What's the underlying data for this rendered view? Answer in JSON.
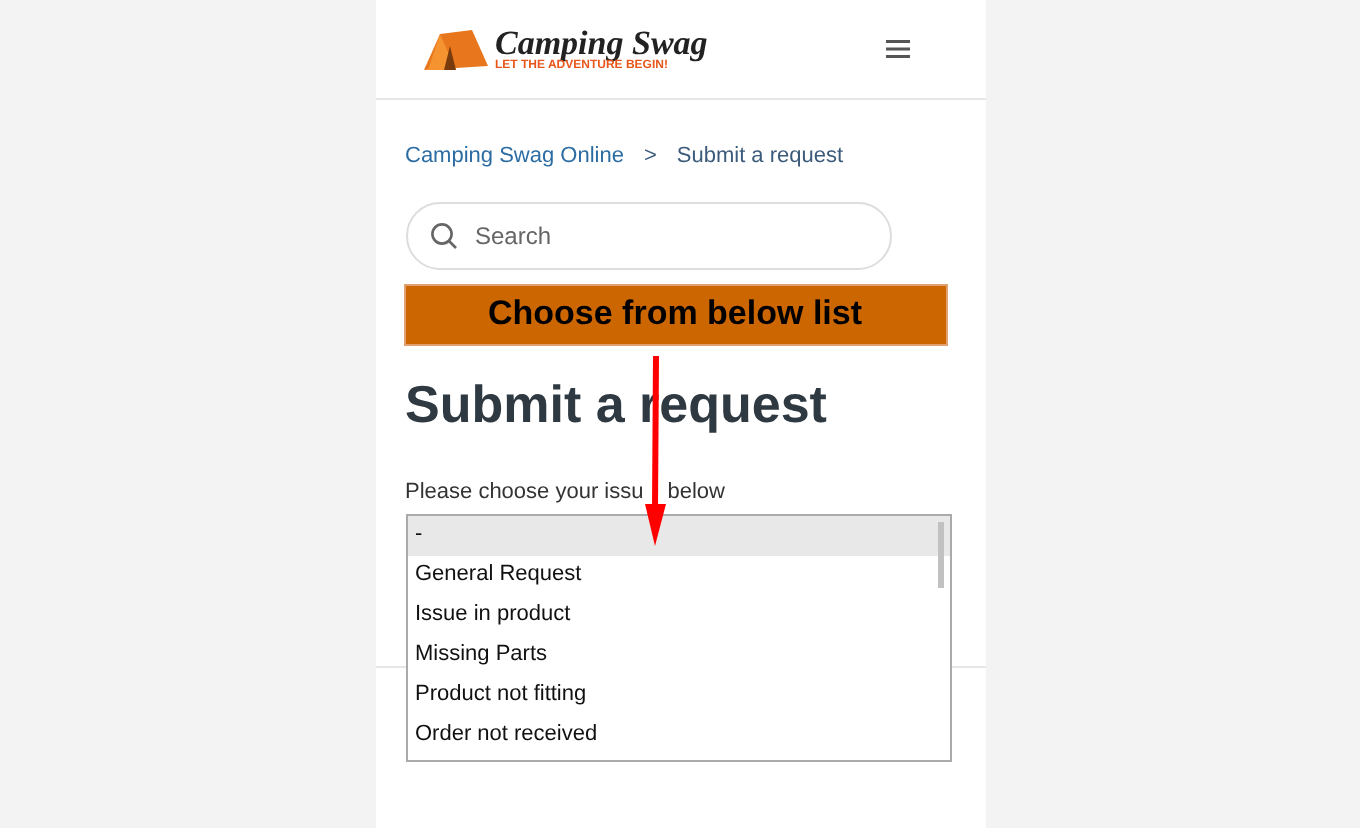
{
  "header": {
    "logo_title": "Camping Swag",
    "logo_tagline": "LET THE ADVENTURE BEGIN!"
  },
  "breadcrumb": [
    {
      "label": "Camping Swag Online",
      "kind": "link"
    },
    {
      "label": ">",
      "kind": "separator"
    },
    {
      "label": "Submit a request",
      "kind": "current"
    }
  ],
  "search": {
    "placeholder": "Search"
  },
  "banner": "Choose from below list",
  "heading": "Submit a request",
  "field_label": [
    "Please choose your issu",
    "below"
  ],
  "options": [
    {
      "label": "-",
      "selected": true
    },
    {
      "label": "General Request",
      "selected": false
    },
    {
      "label": "Issue in product",
      "selected": false
    },
    {
      "label": "Missing Parts",
      "selected": false
    },
    {
      "label": "Product not fitting",
      "selected": false
    },
    {
      "label": "Order not received",
      "selected": false
    }
  ]
}
